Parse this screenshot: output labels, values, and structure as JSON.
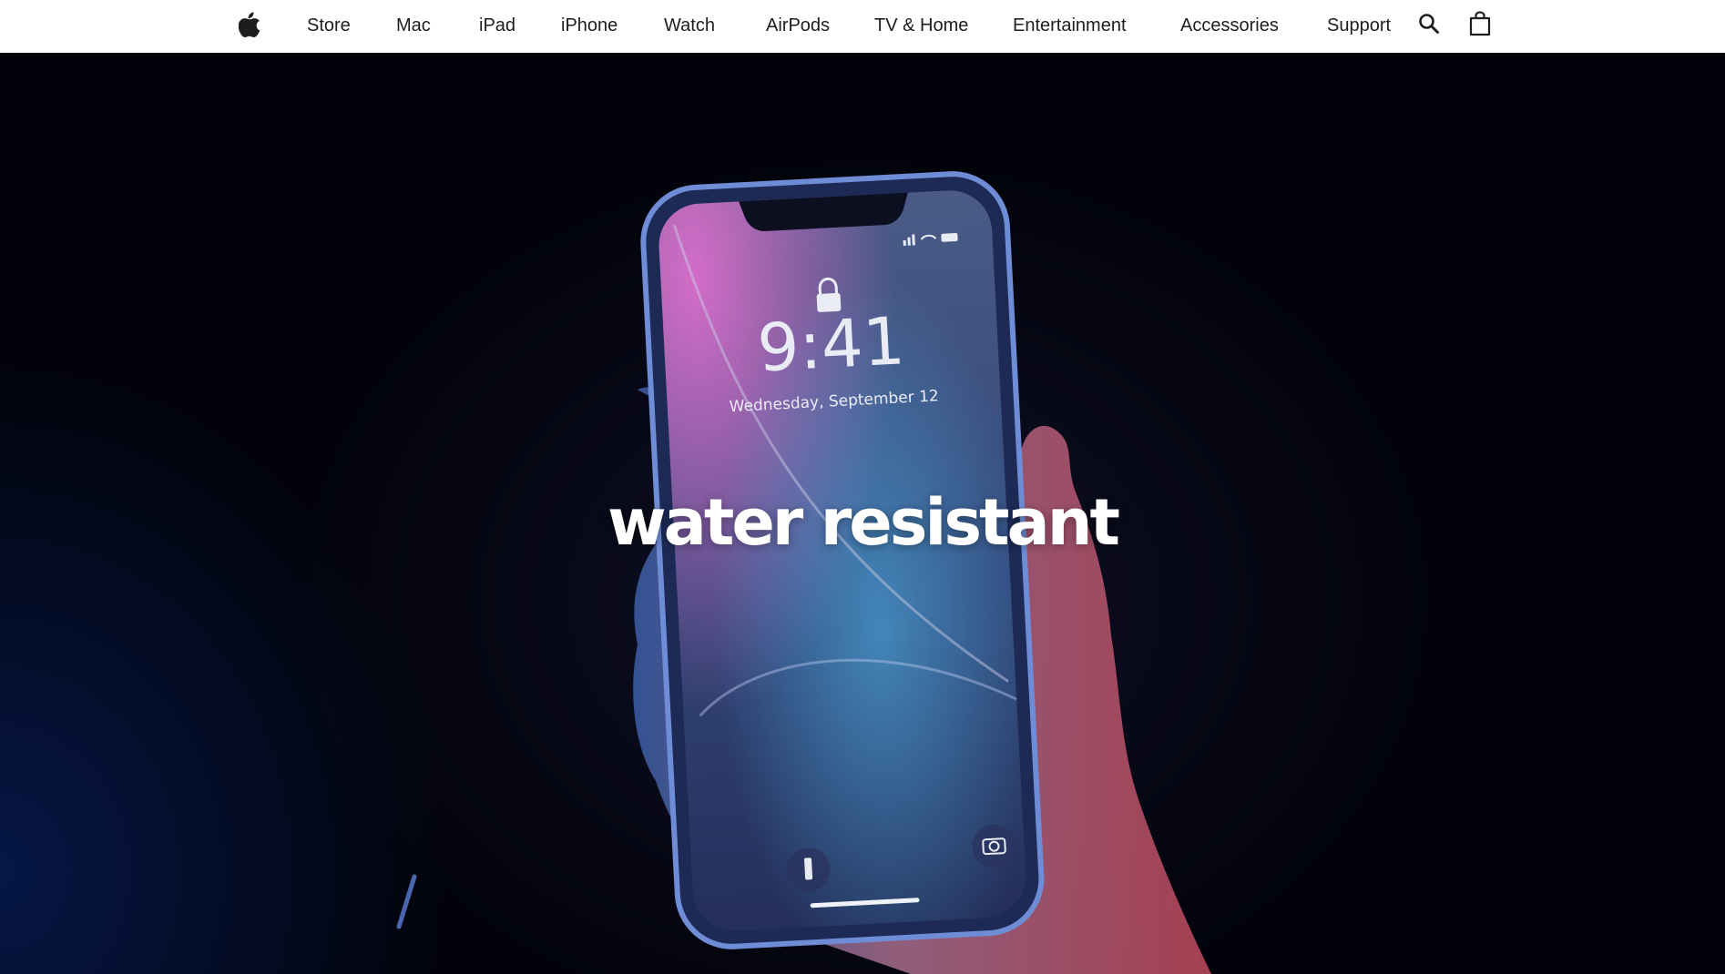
{
  "nav": {
    "logo_icon": "apple-logo-icon",
    "items": [
      {
        "label": "Store"
      },
      {
        "label": "Mac"
      },
      {
        "label": "iPad"
      },
      {
        "label": "iPhone"
      },
      {
        "label": "Watch"
      },
      {
        "label": "AirPods"
      },
      {
        "label": "TV & Home"
      },
      {
        "label": "Entertainment"
      },
      {
        "label": "Accessories"
      },
      {
        "label": "Support"
      }
    ],
    "search_icon": "search-icon",
    "bag_icon": "shopping-bag-icon"
  },
  "hero": {
    "headline": "water resistant",
    "phone": {
      "time": "9:41",
      "date": "Wednesday, September 12",
      "lock_icon": "lock-icon",
      "flashlight_icon": "flashlight-icon",
      "camera_icon": "camera-icon"
    }
  },
  "colors": {
    "nav_background": "#ffffff",
    "nav_text": "#1d1d1f",
    "hero_background": "#02030a",
    "headline": "#ffffff"
  }
}
